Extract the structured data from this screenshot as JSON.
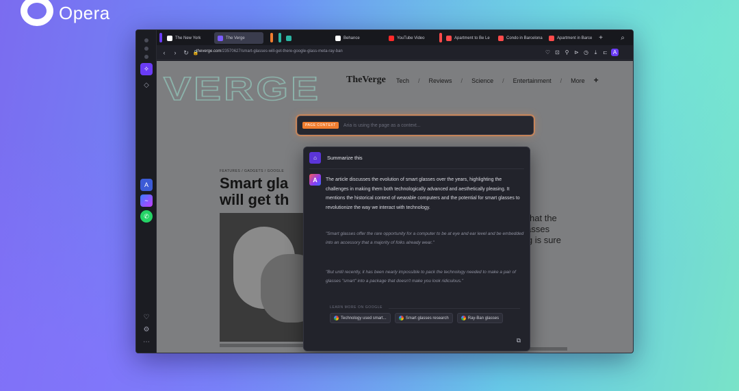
{
  "brand": {
    "name": "Opera"
  },
  "tabs": [
    {
      "label": "The New York",
      "color": "#ffffff"
    },
    {
      "label": "The Verge",
      "color": "#7b5cff"
    },
    {
      "label": "",
      "color": "#2bb5a3"
    },
    {
      "label": "Behance",
      "color": "#ffffff"
    },
    {
      "label": "YouTube Video",
      "color": "#ff2a2a"
    },
    {
      "label": "Apartment to Be Le",
      "color": "#ff4b4b"
    },
    {
      "label": "Condo in Barcelona",
      "color": "#ff4b4b"
    },
    {
      "label": "Apartment in Barce",
      "color": "#ff4b4b"
    }
  ],
  "address": {
    "domain": "theverge.com",
    "path": "/23570627/smart-glasses-will-get-there-google-glass-meta-ray-ban"
  },
  "page": {
    "logo": "TheVerge",
    "nav": [
      "Tech",
      "Reviews",
      "Science",
      "Entertainment",
      "More"
    ],
    "nav_plus": "+",
    "eyebrow": "FEATURES / GADGETS / GOOGLE",
    "headline_line1": "Smart gla",
    "headline_line2": "will get th",
    "right_line1": "ed so that the",
    "right_line2": "glasses",
    "right_line3": "ching is sure"
  },
  "prompt": {
    "context_chip": "PAGE CONTEXT",
    "placeholder": "Aria is using the page as a context..."
  },
  "chat": {
    "user_message": "Summarize this",
    "answer": "The article discusses the evolution of smart glasses over the years, highlighting the challenges in making them both technologically advanced and aesthetically pleasing. It mentions the historical context of wearable computers and the potential for smart glasses to revolutionize the way we interact with technology.",
    "quote1": "\"Smart glasses offer the rare opportunity for a computer to be at eye and ear level and be embedded into an accessory that a majority of folks already wear.\"",
    "quote2": "\"But until recently, it has been nearly impossible to pack the technology needed to make a pair of glasses \"smart\" into a package that doesn't make you look ridiculous.\"",
    "sources_label": "LEARN MORE ON GOOGLE",
    "sources": [
      "Technology used smart...",
      "Smart glasses research",
      "Ray-Ban glasses"
    ]
  }
}
